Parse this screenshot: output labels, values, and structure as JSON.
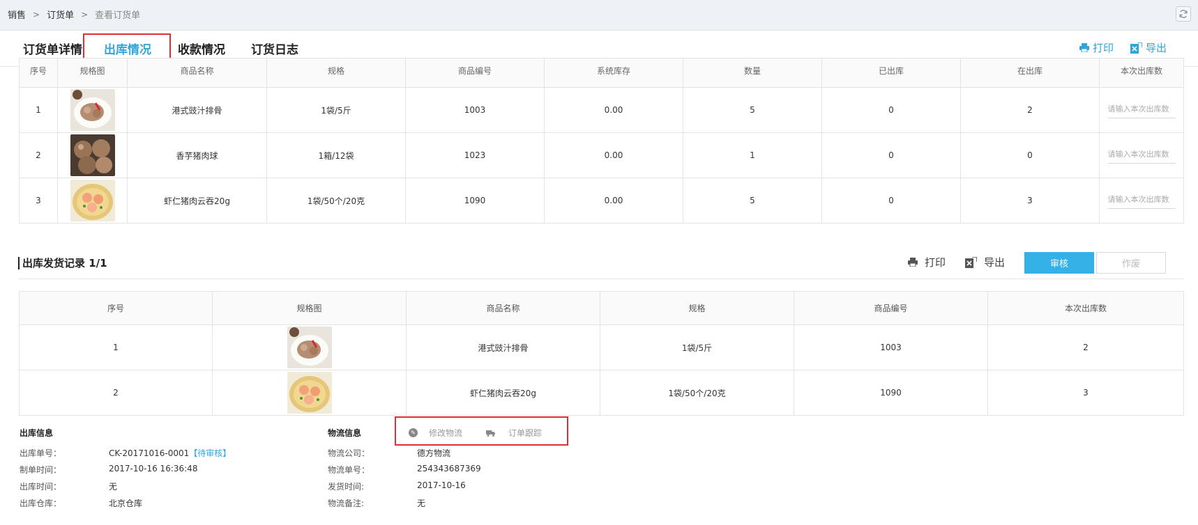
{
  "breadcrumb": [
    "销售",
    "订货单",
    "查看订货单"
  ],
  "tabs": [
    "订货单详情",
    "出库情况",
    "收款情况",
    "订货日志"
  ],
  "top_actions": {
    "print": "打印",
    "export": "导出"
  },
  "stock_table": {
    "headers": [
      "序号",
      "规格图",
      "商品名称",
      "规格",
      "商品编号",
      "系统库存",
      "数量",
      "已出库",
      "在出库",
      "本次出库数"
    ],
    "rows": [
      {
        "no": "1",
        "name": "港式豉汁排骨",
        "spec": "1袋/5斤",
        "code": "1003",
        "stock": "0.00",
        "qty": "5",
        "shipped": "0",
        "shipping": "2"
      },
      {
        "no": "2",
        "name": "香芋猪肉球",
        "spec": "1箱/12袋",
        "code": "1023",
        "stock": "0.00",
        "qty": "1",
        "shipped": "0",
        "shipping": "0"
      },
      {
        "no": "3",
        "name": "虾仁猪肉云吞20g",
        "spec": "1袋/50个/20克",
        "code": "1090",
        "stock": "0.00",
        "qty": "5",
        "shipped": "0",
        "shipping": "3"
      }
    ],
    "input_placeholder": "请输入本次出库数"
  },
  "record": {
    "title": "出库发货记录 1/1",
    "print": "打印",
    "export": "导出",
    "audit_button": "审核",
    "void_button": "作废",
    "headers": [
      "序号",
      "规格图",
      "商品名称",
      "规格",
      "商品编号",
      "本次出库数"
    ],
    "rows": [
      {
        "no": "1",
        "name": "港式豉汁排骨",
        "spec": "1袋/5斤",
        "code": "1003",
        "count": "2"
      },
      {
        "no": "2",
        "name": "虾仁猪肉云吞20g",
        "spec": "1袋/50个/20克",
        "code": "1090",
        "count": "3"
      }
    ]
  },
  "outbound_info": {
    "title": "出库信息",
    "order_no_label": "出库单号：",
    "order_no": "CK-20171016-0001",
    "status": "【待审核】",
    "created_label": "制单时间：",
    "created": "2017-10-16 16:36:48",
    "out_time_label": "出库时间：",
    "out_time": "无",
    "warehouse_label": "出库仓库：",
    "warehouse": "北京仓库"
  },
  "logistics_info": {
    "title": "物流信息",
    "edit_label": "修改物流",
    "track_label": "订单跟踪",
    "company_label": "物流公司：",
    "company": "德方物流",
    "tracking_label": "物流单号：",
    "tracking": "254343687369",
    "ship_time_label": "发货时间:",
    "ship_time": "2017-10-16",
    "remark_label": "物流备注:",
    "remark": "无"
  },
  "colors": {
    "accent": "#2ea6dc",
    "audit_button": "#34b1e6",
    "highlight_box": "#e0302d"
  }
}
